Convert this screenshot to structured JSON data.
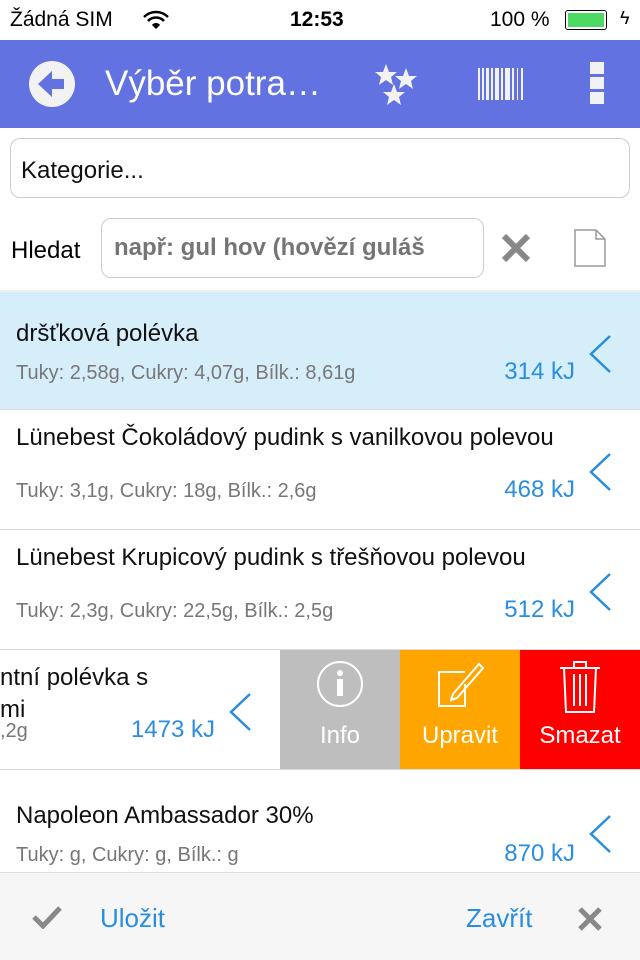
{
  "status_bar": {
    "carrier": "Žádná SIM",
    "time": "12:53",
    "battery": "100 %",
    "battery_color": "#4cd964"
  },
  "nav": {
    "title": "Výběr potra…",
    "bg_color": "#6273e1",
    "icons": [
      "back-arrow-icon",
      "stars-icon",
      "barcode-icon",
      "more-vertical-icon"
    ]
  },
  "category": {
    "value": "Kategorie..."
  },
  "search": {
    "label": "Hledat",
    "placeholder": "např: gul hov (hovězí guláš"
  },
  "items": [
    {
      "title": "dršťková polévka",
      "sub": "Tuky: 2,58g, Cukry: 4,07g, Bílk.: 8,61g",
      "energy": "314 kJ",
      "selected": true
    },
    {
      "title": "Lünebest Čokoládový pudink s vanilkovou polevou",
      "sub": "Tuky: 3,1g, Cukry: 18g, Bílk.: 2,6g",
      "energy": "468 kJ"
    },
    {
      "title": "Lünebest Krupicový pudink s třešňovou polevou",
      "sub": "Tuky: 2,3g, Cukry: 22,5g, Bílk.: 2,5g",
      "energy": "512 kJ"
    },
    {
      "title_line1": "ntní polévka s",
      "title_line2": "mi",
      "sub": ",2g",
      "energy": "1473 kJ",
      "swiped": true
    },
    {
      "title": "Napoleon Ambassador 30%",
      "sub": "Tuky: g, Cukry: g, Bílk.: g",
      "energy": "870 kJ"
    }
  ],
  "swipe_actions": [
    {
      "label": "Info",
      "color": "#bebebe",
      "icon": "info-icon"
    },
    {
      "label": "Upravit",
      "color": "#ffa500",
      "icon": "edit-icon"
    },
    {
      "label": "Smazat",
      "color": "#ff0000",
      "icon": "trash-icon"
    }
  ],
  "toolbar": {
    "save": "Uložit",
    "close": "Zavřít"
  }
}
